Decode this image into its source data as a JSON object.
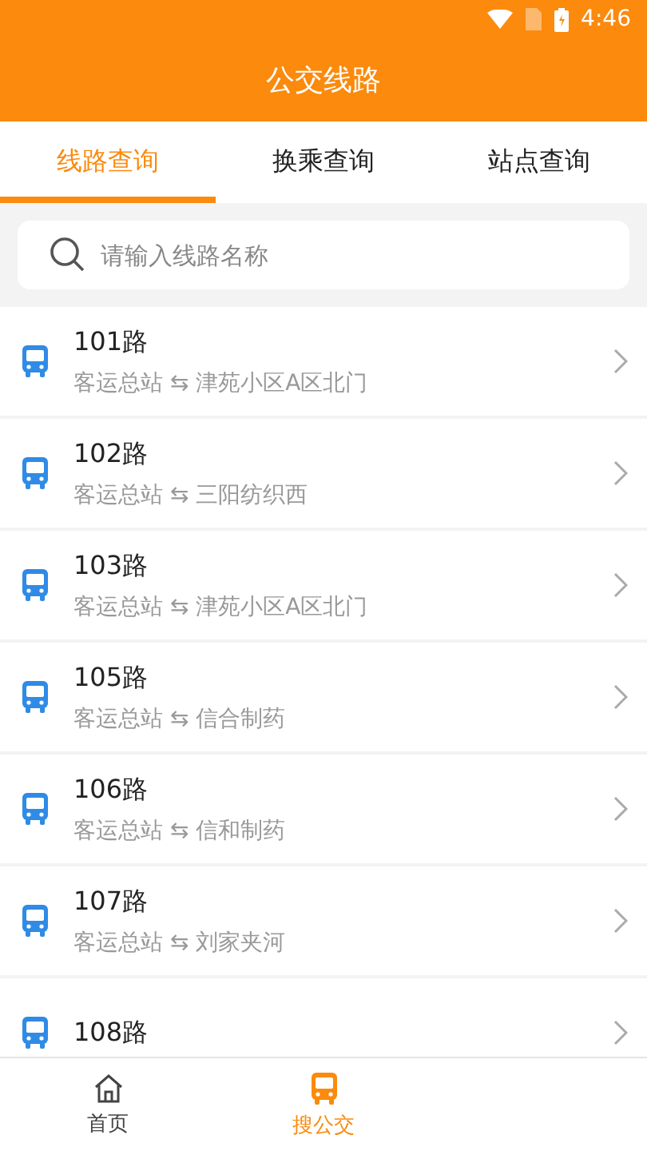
{
  "status_bar": {
    "time": "4:46"
  },
  "header": {
    "title": "公交线路"
  },
  "tabs": [
    {
      "label": "线路查询",
      "selected": true
    },
    {
      "label": "换乘查询",
      "selected": false
    },
    {
      "label": "站点查询",
      "selected": false
    }
  ],
  "search": {
    "placeholder": "请输入线路名称"
  },
  "routes": [
    {
      "name": "101路",
      "from": "客运总站",
      "to": "津苑小区A区北门"
    },
    {
      "name": "102路",
      "from": "客运总站",
      "to": "三阳纺织西"
    },
    {
      "name": "103路",
      "from": "客运总站",
      "to": "津苑小区A区北门"
    },
    {
      "name": "105路",
      "from": "客运总站",
      "to": "信合制药"
    },
    {
      "name": "106路",
      "from": "客运总站",
      "to": "信和制药"
    },
    {
      "name": "107路",
      "from": "客运总站",
      "to": "刘家夹河"
    },
    {
      "name": "108路"
    }
  ],
  "route_separator": "⇆",
  "bottom_nav": [
    {
      "label": "首页",
      "kind": "home",
      "selected": false
    },
    {
      "label": "搜公交",
      "kind": "bus",
      "selected": true
    }
  ]
}
